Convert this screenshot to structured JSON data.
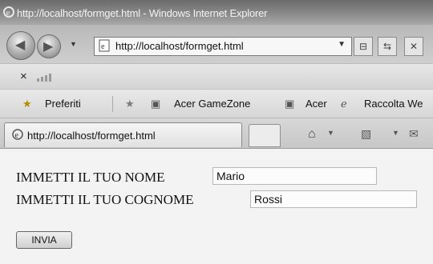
{
  "window": {
    "title": "http://localhost/formget.html - Windows Internet Explorer"
  },
  "toolbar": {
    "address": "http://localhost/formget.html",
    "icons": [
      "back-arrow-icon",
      "forward-arrow-icon",
      "compat-view-icon",
      "refresh-icon",
      "stop-icon"
    ]
  },
  "menu": {
    "close_symbol": "×"
  },
  "favorites": {
    "label": "Preferiti",
    "items": [
      "Acer GameZone",
      "Acer",
      "Raccolta We"
    ]
  },
  "tabs": [
    {
      "label": "http://localhost/formget.html"
    }
  ],
  "form": {
    "nome_label": "IMMETTI IL TUO NOME",
    "nome_value": "Mario",
    "cognome_label": "IMMETTI IL TUO COGNOME",
    "cognome_value": "Rossi",
    "submit_label": "INVIA"
  },
  "colors": {
    "titlebar": "#7f7f7f",
    "content_bg": "#f3f3f3"
  }
}
